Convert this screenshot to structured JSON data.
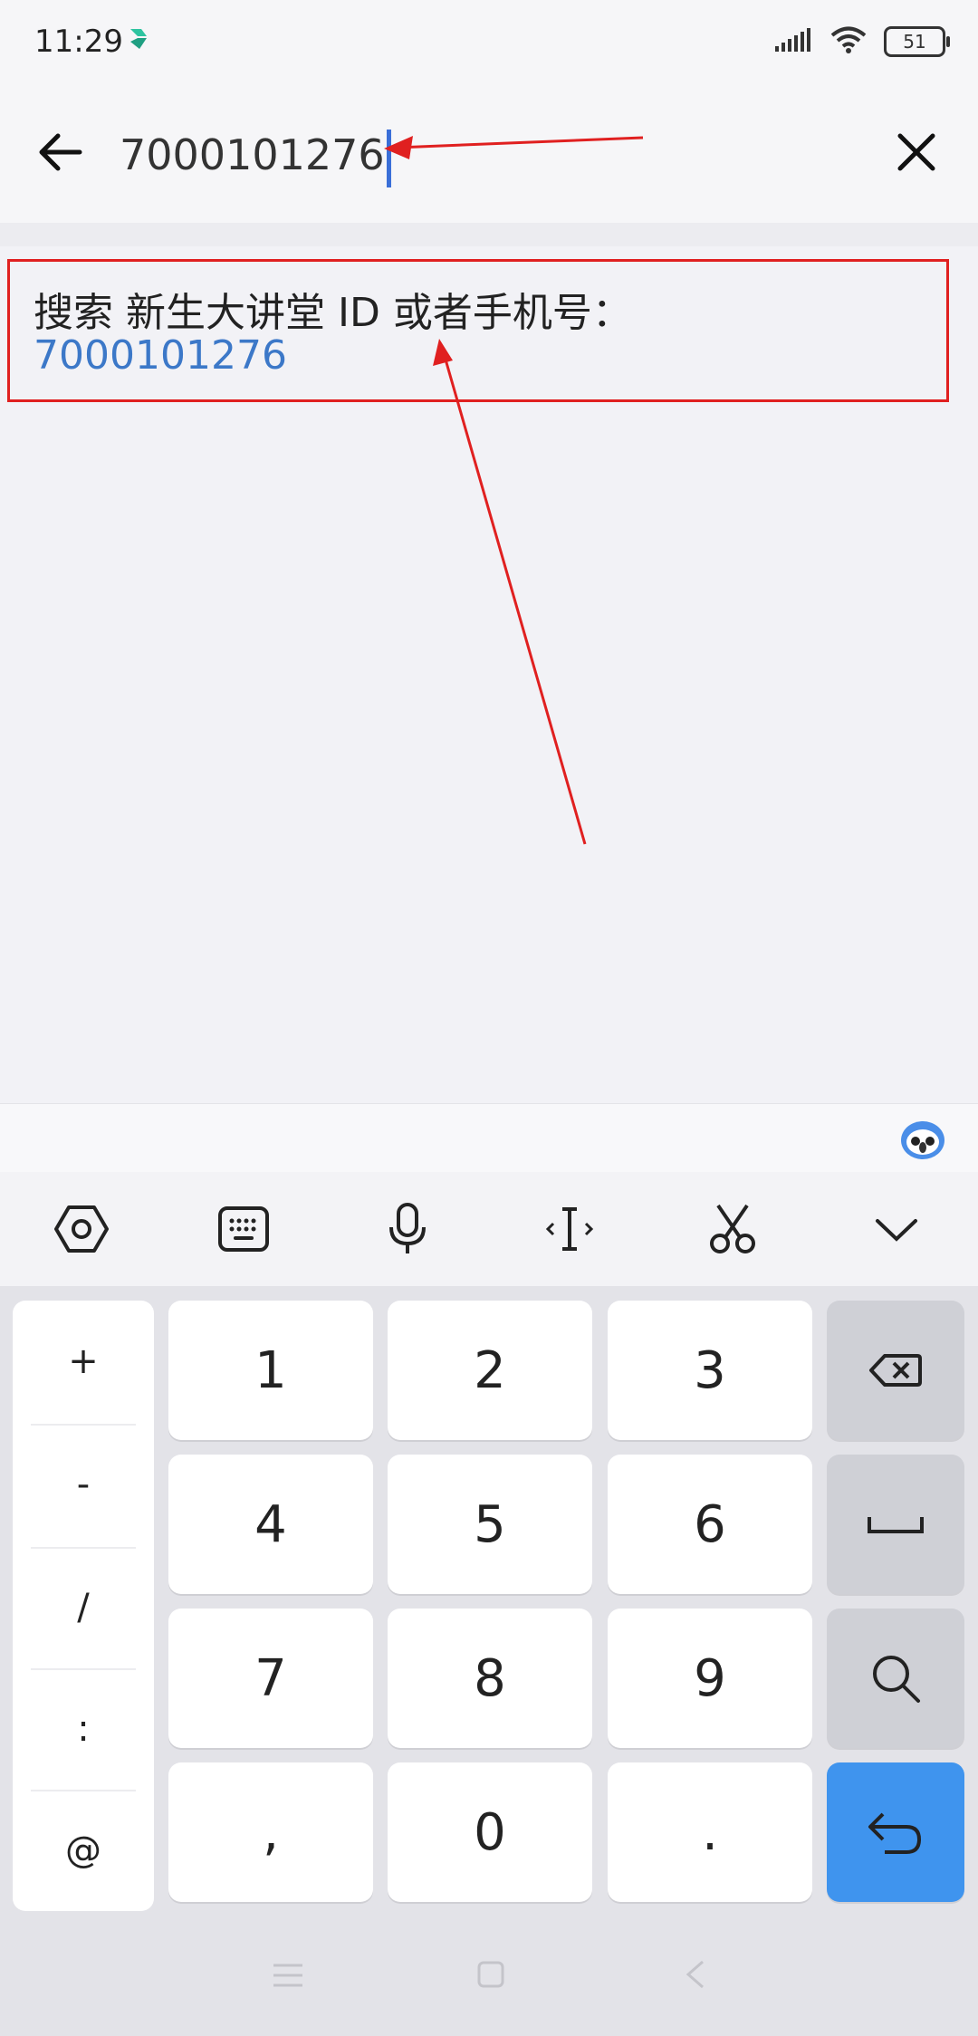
{
  "status": {
    "time": "11:29",
    "battery": "51"
  },
  "search": {
    "query": "7000101276"
  },
  "result": {
    "prefix": "搜索 新生大讲堂 ID 或者手机号：",
    "value": "7000101276"
  },
  "keyboard": {
    "symbols": [
      "+",
      "-",
      "/",
      ":",
      "@"
    ],
    "rows": [
      [
        "1",
        "2",
        "3"
      ],
      [
        "4",
        "5",
        "6"
      ],
      [
        "7",
        "8",
        "9"
      ],
      [
        ",",
        "0",
        "."
      ]
    ]
  },
  "colors": {
    "accent": "#3f94ee",
    "link": "#3c78c8",
    "annotation": "#e02020"
  }
}
